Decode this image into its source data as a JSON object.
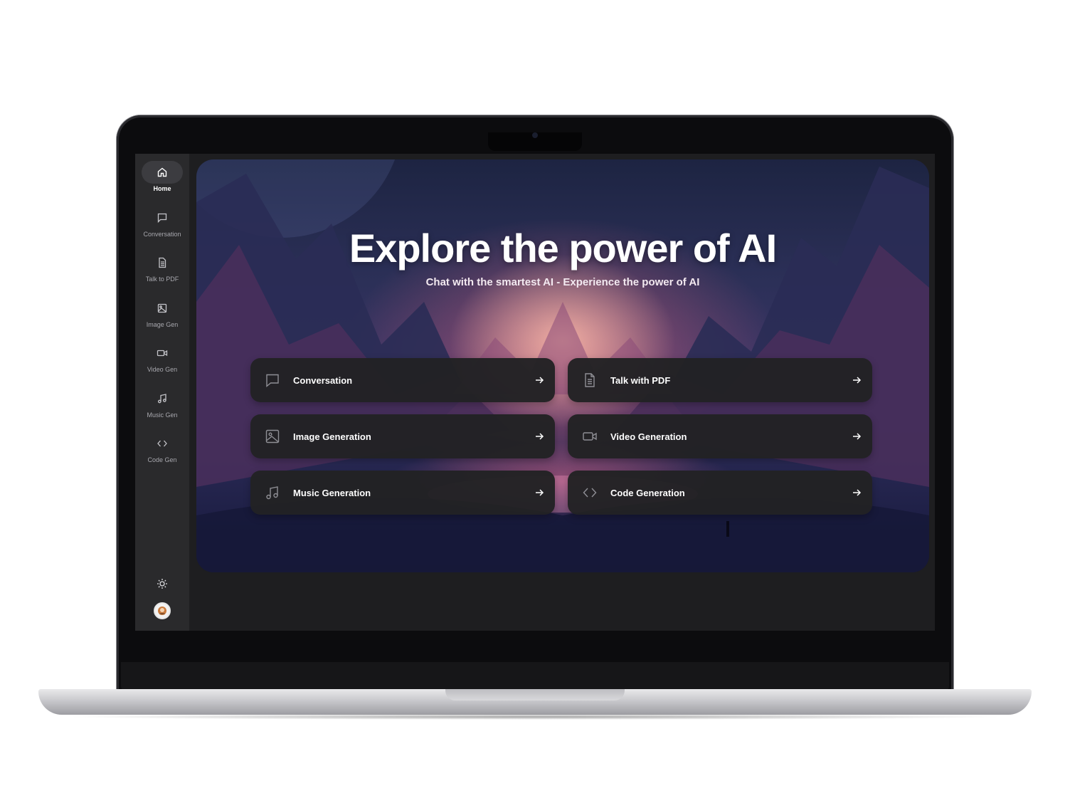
{
  "hero": {
    "title": "Explore the power of AI",
    "subtitle": "Chat with the smartest AI - Experience the power of AI"
  },
  "sidebar": {
    "items": [
      {
        "label": "Home",
        "icon": "home-icon",
        "active": true
      },
      {
        "label": "Conversation",
        "icon": "chat-bubble-icon",
        "active": false
      },
      {
        "label": "Talk to PDF",
        "icon": "document-icon",
        "active": false
      },
      {
        "label": "Image Gen",
        "icon": "image-icon",
        "active": false
      },
      {
        "label": "Video Gen",
        "icon": "video-camera-icon",
        "active": false
      },
      {
        "label": "Music Gen",
        "icon": "music-note-icon",
        "active": false
      },
      {
        "label": "Code Gen",
        "icon": "code-brackets-icon",
        "active": false
      }
    ],
    "theme_icon": "sun-icon",
    "avatar_icon": "user-avatar"
  },
  "cards": [
    {
      "label": "Conversation",
      "icon": "chat-bubble-icon"
    },
    {
      "label": "Talk with PDF",
      "icon": "document-icon"
    },
    {
      "label": "Image Generation",
      "icon": "image-icon"
    },
    {
      "label": "Video Generation",
      "icon": "video-camera-icon"
    },
    {
      "label": "Music Generation",
      "icon": "music-note-icon"
    },
    {
      "label": "Code Generation",
      "icon": "code-brackets-icon"
    }
  ],
  "colors": {
    "sidebar": "#2a2a2c",
    "card": "#222224",
    "screen": "#1e1e20",
    "text": "#ffffff"
  }
}
